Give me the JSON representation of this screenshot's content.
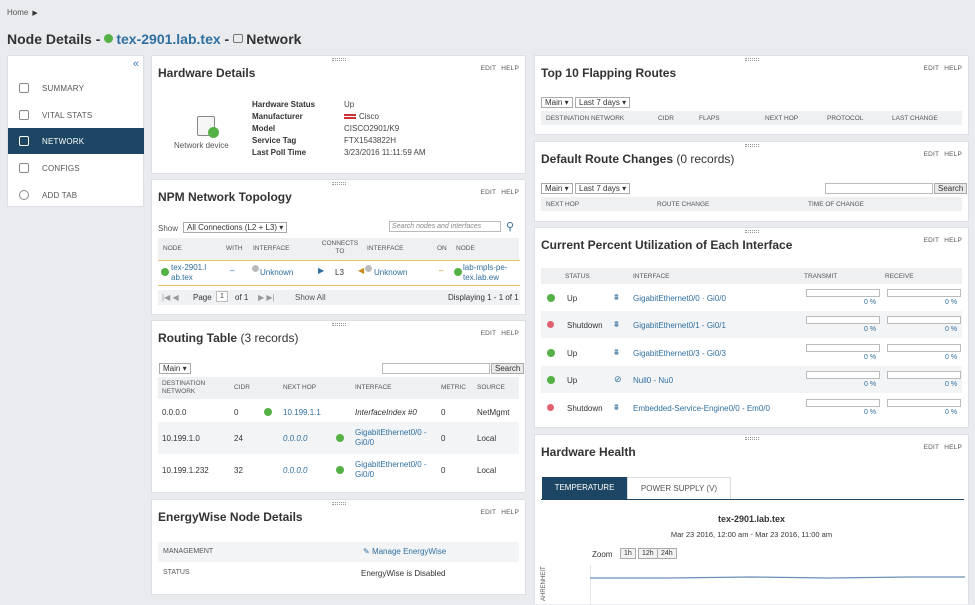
{
  "breadcrumb": {
    "home": "Home"
  },
  "title": {
    "prefix": "Node Details -",
    "node": "tex-2901.lab.tex",
    "sep": "-",
    "section": "Network"
  },
  "nav": {
    "items": [
      {
        "label": "SUMMARY",
        "icon": "home-icon"
      },
      {
        "label": "VITAL STATS",
        "icon": "vital-stats-icon"
      },
      {
        "label": "NETWORK",
        "icon": "network-icon",
        "active": true
      },
      {
        "label": "CONFIGS",
        "icon": "configs-icon"
      },
      {
        "label": "ADD TAB",
        "icon": "add-icon"
      }
    ]
  },
  "panel_actions": {
    "edit": "EDIT",
    "help": "HELP"
  },
  "hardware_details": {
    "title": "Hardware Details",
    "device_label": "Network device",
    "fields": [
      {
        "label": "Hardware Status",
        "value": "Up"
      },
      {
        "label": "Manufacturer",
        "value": "Cisco"
      },
      {
        "label": "Model",
        "value": "CISCO2901/K9"
      },
      {
        "label": "Service Tag",
        "value": "FTX1543822H"
      },
      {
        "label": "Last Poll Time",
        "value": "3/23/2016 11:11:59 AM"
      }
    ]
  },
  "topology": {
    "title": "NPM Network Topology",
    "show_label": "Show",
    "show_value": "All Connections (L2 + L3) ▾",
    "search_placeholder": "Search nodes and interfaces",
    "headers": [
      "NODE",
      "WITH",
      "INTERFACE",
      "CONNECTS TO",
      "INTERFACE",
      "ON",
      "NODE"
    ],
    "row": {
      "node": "tex-2901.l ab.tex",
      "with": "–",
      "iface1": "Unknown",
      "connects": "L3",
      "iface2": "Unknown",
      "on": "–",
      "node2": "lab-mpls-pe-tex.lab.ew"
    },
    "pager": {
      "page": "Page",
      "page_num": "1",
      "of": "of 1",
      "show_all": "Show All",
      "displaying": "Displaying 1 - 1 of 1"
    }
  },
  "routing": {
    "title": "Routing Table",
    "count": "(3 records)",
    "select": "Main ▾",
    "search_btn": "Search",
    "headers": [
      "DESTINATION NETWORK",
      "CIDR",
      "NEXT HOP",
      "INTERFACE",
      "METRIC",
      "SOURCE"
    ],
    "rows": [
      {
        "dest": "0.0.0.0",
        "cidr": "0",
        "hop": "10.199.1.1",
        "iface": "InterfaceIndex #0",
        "metric": "0",
        "source": "NetMgmt"
      },
      {
        "dest": "10.199.1.0",
        "cidr": "24",
        "hop": "0.0.0.0",
        "iface": "GigabitEthernet0/0 - Gi0/0",
        "metric": "0",
        "source": "Local"
      },
      {
        "dest": "10.199.1.232",
        "cidr": "32",
        "hop": "0.0.0.0",
        "iface": "GigabitEthernet0/0 - Gi0/0",
        "metric": "0",
        "source": "Local"
      }
    ]
  },
  "energywise": {
    "title": "EnergyWise Node Details",
    "mgmt_label": "MANAGEMENT",
    "mgmt_link": "Manage EnergyWise",
    "status_label": "STATUS",
    "status_value": "EnergyWise is Disabled"
  },
  "flapping": {
    "title": "Top 10 Flapping Routes",
    "select1": "Main ▾",
    "select2": "Last 7 days ▾",
    "headers": [
      "DESTINATION NETWORK",
      "CIDR",
      "FLAPS",
      "NEXT HOP",
      "PROTOCOL",
      "LAST CHANGE"
    ]
  },
  "default_route": {
    "title": "Default Route Changes",
    "count": "(0 records)",
    "select1": "Main ▾",
    "select2": "Last 7 days ▾",
    "search_btn": "Search",
    "headers": [
      "NEXT HOP",
      "ROUTE CHANGE",
      "TIME OF CHANGE"
    ]
  },
  "utilization": {
    "title": "Current Percent Utilization of Each Interface",
    "headers": [
      "STATUS",
      "INTERFACE",
      "TRANSMIT",
      "RECEIVE"
    ],
    "rows": [
      {
        "status": "Up",
        "iface": "GigabitEthernet0/0 · Gi0/0",
        "tx": "0 %",
        "rx": "0 %",
        "state": "up"
      },
      {
        "status": "Shutdown",
        "iface": "GigabitEthernet0/1 - Gi0/1",
        "tx": "0 %",
        "rx": "0 %",
        "state": "down"
      },
      {
        "status": "Up",
        "iface": "GigabitEthernet0/3 - Gi0/3",
        "tx": "0 %",
        "rx": "0 %",
        "state": "up"
      },
      {
        "status": "Up",
        "iface": "Null0 - Nu0",
        "tx": "0 %",
        "rx": "0 %",
        "state": "up"
      },
      {
        "status": "Shutdown",
        "iface": "Embedded-Service-Engine0/0 - Em0/0",
        "tx": "0 %",
        "rx": "0 %",
        "state": "down"
      }
    ]
  },
  "hw_health": {
    "title": "Hardware Health",
    "tabs": [
      "TEMPERATURE",
      "POWER SUPPLY (V)"
    ],
    "chart_title": "tex-2901.lab.tex",
    "chart_subtitle": "Mar 23 2016, 12:00 am - Mar 23 2016, 11:00 am",
    "zoom_label": "Zoom",
    "zoom_options": [
      "1h",
      "12h",
      "24h"
    ],
    "y_label": "AHRENHEIT"
  },
  "colors": {
    "nav_active": "#1d4664",
    "link": "#2f6f9f",
    "up": "#55b146",
    "down": "#e06070",
    "tab_active": "#1d4664"
  }
}
